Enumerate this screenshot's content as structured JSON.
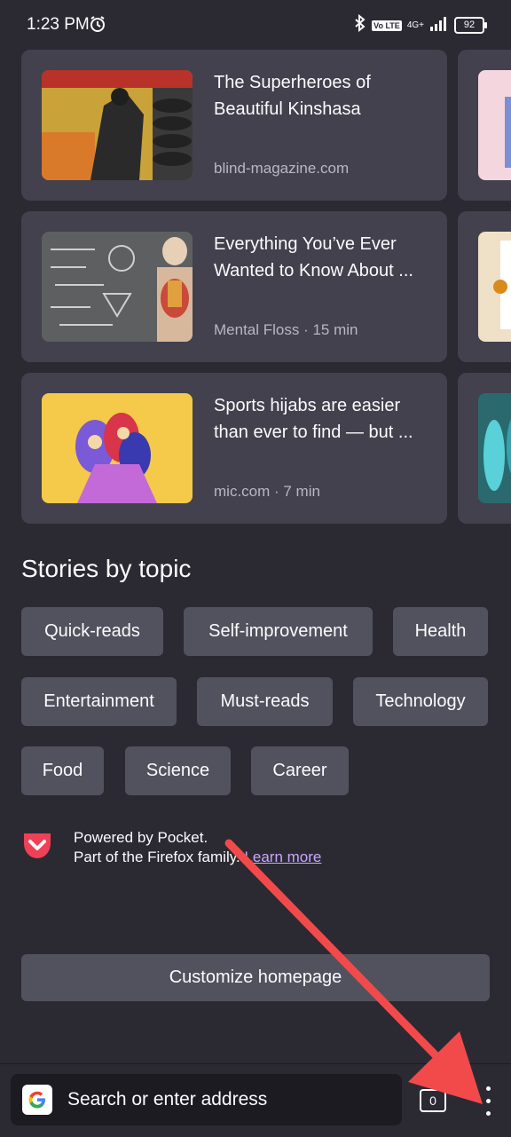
{
  "status_bar": {
    "time": "1:23 PM",
    "network": "4G+",
    "lte_badge": "Vo LTE",
    "battery": "92"
  },
  "stories": [
    {
      "title": "The Superheroes of Beautiful Kinshasa",
      "meta": "blind-magazine.com"
    },
    {
      "title": "Everything You’ve Ever Wanted to Know About ...",
      "meta": "Mental Floss · 15 min"
    },
    {
      "title": "Sports hijabs are easier than ever to find — but ...",
      "meta": "mic.com · 7 min"
    }
  ],
  "topics": {
    "heading": "Stories by topic",
    "chips": [
      "Quick-reads",
      "Self-improvement",
      "Health",
      "Entertainment",
      "Must-reads",
      "Technology",
      "Food",
      "Science",
      "Career"
    ]
  },
  "pocket": {
    "line1": "Powered by Pocket.",
    "line2": "Part of the Firefox family.",
    "link": "Learn more"
  },
  "customize_label": "Customize homepage",
  "toolbar": {
    "search_placeholder": "Search or enter address",
    "tab_count": "0"
  },
  "colors": {
    "background": "#2b2a33",
    "card": "#42414d",
    "chip": "#52525e",
    "link": "#c9a6ff",
    "annotation_arrow": "#f24a4a",
    "pocket_red": "#ef4056"
  }
}
